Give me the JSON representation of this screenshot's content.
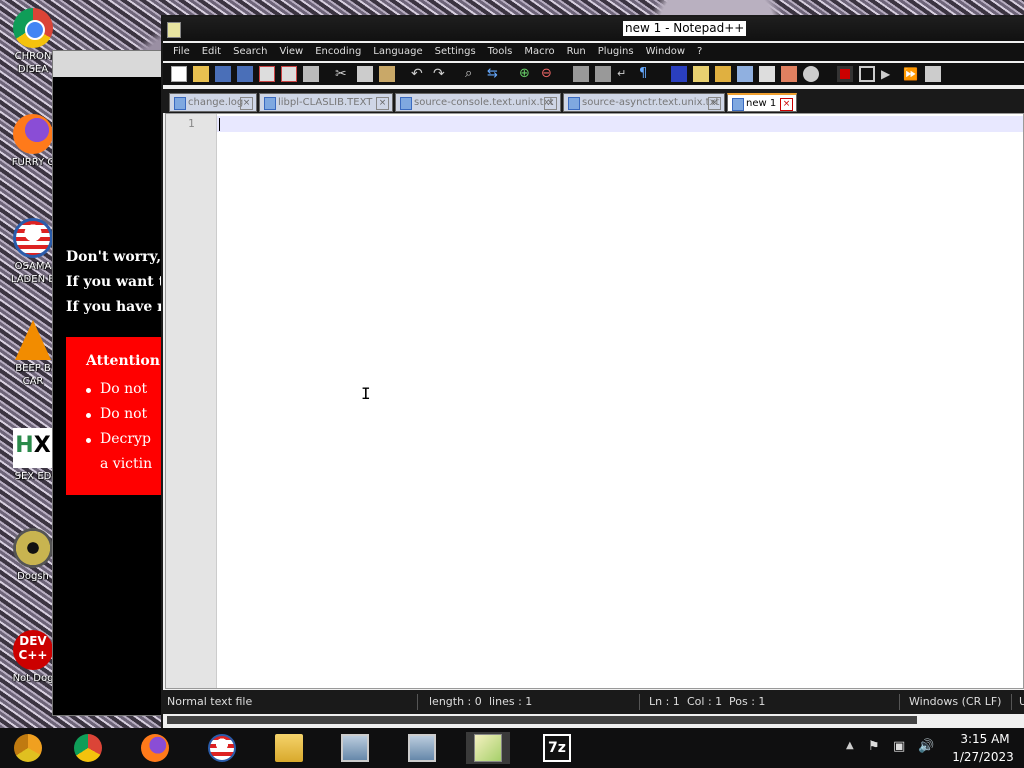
{
  "desktop": {
    "icons": [
      {
        "label": "CHRON\nDISEA",
        "icon": "chrome-icon"
      },
      {
        "label": "FURRY C",
        "icon": "firefox-icon"
      },
      {
        "label": "OSAMA\nLADEN B",
        "icon": "obama-logo-icon"
      },
      {
        "label": "BEEP B\nCAR",
        "icon": "vlc-icon"
      },
      {
        "label": "SEX ED",
        "icon": "hx-icon"
      },
      {
        "label": "Dogsh",
        "icon": "disc-icon"
      },
      {
        "label": "Not Dog",
        "icon": "devcpp-icon"
      }
    ]
  },
  "ransom": {
    "lines": [
      "Don't worry,",
      "If you want t",
      "If you have r"
    ],
    "attention": "Attention!",
    "bullets": [
      "Do not",
      "Do not",
      "Decryp",
      "a victin"
    ]
  },
  "npp": {
    "title": "new 1 - Notepad++",
    "menu": [
      "File",
      "Edit",
      "Search",
      "View",
      "Encoding",
      "Language",
      "Settings",
      "Tools",
      "Macro",
      "Run",
      "Plugins",
      "Window",
      "?"
    ],
    "tabs": [
      {
        "label": "change.log",
        "active": false
      },
      {
        "label": "libpl-CLASLIB.TEXT",
        "active": false
      },
      {
        "label": "source-console.text.unix.txt",
        "active": false
      },
      {
        "label": "source-asynctr.text.unix.txt",
        "active": false
      },
      {
        "label": "new 1",
        "active": true
      }
    ],
    "line_number": "1",
    "status": {
      "filetype": "Normal text file",
      "length": "length : 0",
      "lines": "lines : 1",
      "ln": "Ln : 1",
      "col": "Col : 1",
      "pos": "Pos : 1",
      "eol": "Windows (CR LF)",
      "enc": "U"
    }
  },
  "taskbar": {
    "apps": [
      "chrome-canary-icon",
      "chrome-icon",
      "firefox-icon",
      "obama-logo-icon",
      "file-explorer-icon",
      "network-pc-icon",
      "network-pc-icon",
      "notepadpp-icon",
      "7zip-icon"
    ],
    "sevenzip_label": "7z",
    "clock_time": "3:15 AM",
    "clock_date": "1/27/2023"
  }
}
